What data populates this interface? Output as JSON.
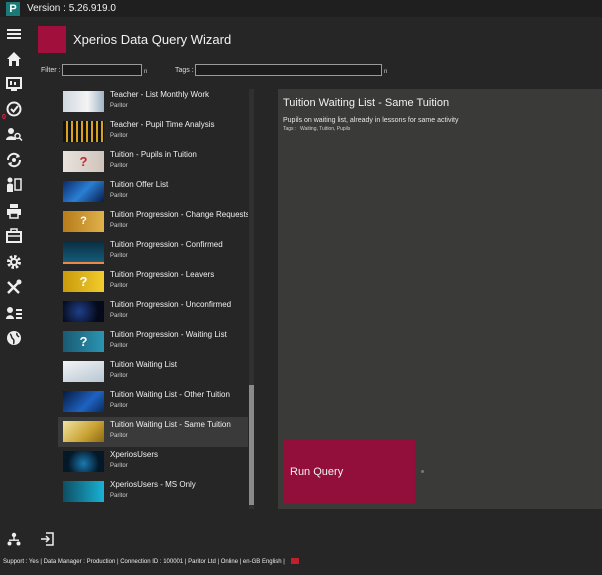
{
  "app": {
    "logo_letter": "P",
    "version": "Version : 5.26.919.0"
  },
  "rail": {
    "badge": "0",
    "items": [
      "menu",
      "home",
      "dashboard",
      "tasks",
      "people-search",
      "sync",
      "clipboard",
      "print",
      "briefcase",
      "settings",
      "tools",
      "user-list",
      "globe"
    ]
  },
  "wizard": {
    "title": "Xperios Data Query Wizard"
  },
  "filters": {
    "filter_label": "Filter :",
    "filter_value": "",
    "tags_label": "Tags :",
    "tags_value": "",
    "clear_glyph": "n"
  },
  "queries": [
    {
      "name": "Teacher - List Monthly Work",
      "owner": "Paritor",
      "thumb": "people"
    },
    {
      "name": "Teacher - Pupil Time Analysis",
      "owner": "Paritor",
      "thumb": "bars-gold"
    },
    {
      "name": "Tuition - Pupils in Tuition",
      "owner": "Paritor",
      "thumb": "question-red"
    },
    {
      "name": "Tuition Offer List",
      "owner": "Paritor",
      "thumb": "blue-data"
    },
    {
      "name": "Tuition Progression - Change Requests",
      "owner": "Paritor",
      "thumb": "question-gold"
    },
    {
      "name": "Tuition Progression - Confirmed",
      "owner": "Paritor",
      "thumb": "stock-chart"
    },
    {
      "name": "Tuition Progression - Leavers",
      "owner": "Paritor",
      "thumb": "question-yellow"
    },
    {
      "name": "Tuition Progression - Unconfirmed",
      "owner": "Paritor",
      "thumb": "dark-lines"
    },
    {
      "name": "Tuition Progression - Waiting List",
      "owner": "Paritor",
      "thumb": "question-teal"
    },
    {
      "name": "Tuition Waiting List",
      "owner": "Paritor",
      "thumb": "graph-white"
    },
    {
      "name": "Tuition Waiting List - Other Tuition",
      "owner": "Paritor",
      "thumb": "blue-wave"
    },
    {
      "name": "Tuition Waiting List - Same Tuition",
      "owner": "Paritor",
      "thumb": "gold-coins"
    },
    {
      "name": "XperiosUsers",
      "owner": "Paritor",
      "thumb": "network-blue"
    },
    {
      "name": "XperiosUsers - MS Only",
      "owner": "Paritor",
      "thumb": "cyan-hand"
    }
  ],
  "selected_index": 11,
  "detail": {
    "title": "Tuition Waiting List - Same Tuition",
    "description": "Pupils on waiting list, already in lessons for same activity",
    "tags_label": "Tags :",
    "tags": "Waiting, Tuition, Pupils",
    "run_label": "Run Query"
  },
  "status": {
    "text": "Support : Yes | Data Manager : Production | Connection ID : 100001 | Paritor Ltd | Online | en-GB  English  |"
  },
  "colors": {
    "accent": "#930f3b",
    "background": "#262626",
    "panel": "#3a3b38"
  }
}
